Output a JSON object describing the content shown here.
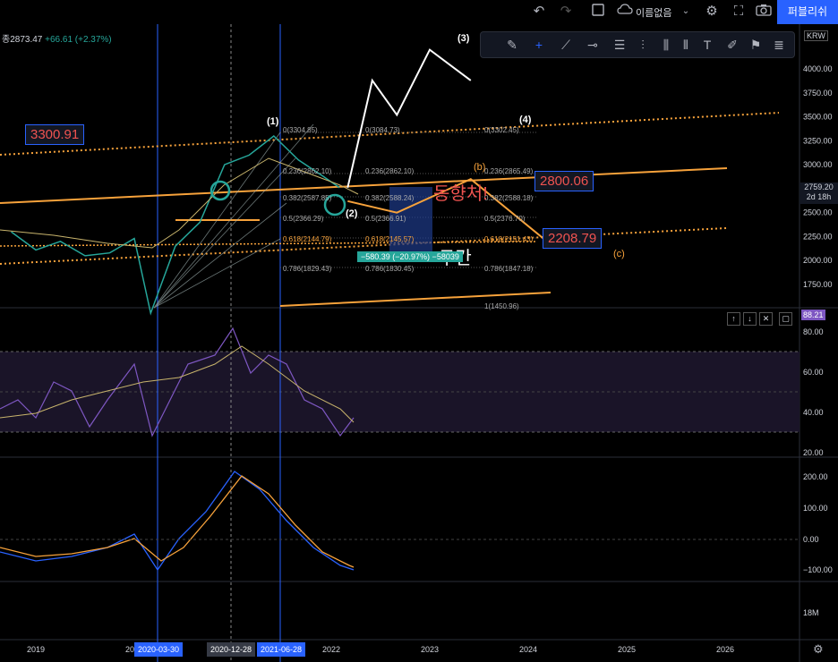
{
  "topbar": {
    "layout_name": "이름없음",
    "publish_label": "퍼블리쉬"
  },
  "symbol": {
    "info_prefix": "종",
    "price": "2873.47",
    "change": "+66.61 (+2.37%)"
  },
  "currency": "KRW",
  "annotations": {
    "top_left_price": "3300.91",
    "target_b": "2800.06",
    "target_c": "2208.79",
    "text_red": "동향처!",
    "text_white": "구간",
    "measure": "−580.39 (−20.97%) −58039"
  },
  "last_price": {
    "value": "2759.20",
    "timer": "2d 18h"
  },
  "waves": {
    "w1": "(1)",
    "w2": "(2)",
    "w3": "(3)",
    "w4": "(4)",
    "wb": "(b)",
    "wc": "(c)"
  },
  "fib": {
    "left": [
      "0(3304.85)",
      "0.236(2862.10)",
      "0.382(2587.85)",
      "0.5(2366.29)",
      "0.618(2144.79)",
      "0.786(1829.43)"
    ],
    "mid": [
      "0(3084.73)",
      "0.236(2862.10)",
      "0.382(2588.24)",
      "0.5(2366.91)",
      "0.618(2145.57)",
      "0.786(1830.45)"
    ],
    "right": [
      "0(3302.45)",
      "0.236(2865.49)",
      "0.382(2588.18)",
      "0.5(2376.70)",
      "0.618(2151.43)",
      "0.786(1847.18)",
      "1(1450.96)"
    ]
  },
  "rsi": {
    "value": "88.21",
    "ticks": [
      "80.00",
      "60.00",
      "40.00",
      "20.00"
    ]
  },
  "macd": {
    "ticks": [
      "200.00",
      "100.00",
      "0.00",
      "−100.00"
    ],
    "volume_tick": "18M"
  },
  "date_tags": [
    "2020-03-30",
    "2020-12-28",
    "2021-06-28"
  ],
  "chart_data": {
    "type": "line",
    "title": "",
    "price_axis": [
      "4000.00",
      "3750.00",
      "3500.00",
      "3250.00",
      "3000.00",
      "2750.00",
      "2500.00",
      "2250.00",
      "2000.00",
      "1750.00"
    ],
    "ylim": [
      1500,
      4250
    ],
    "time_axis": [
      "2019",
      "2020",
      "2021",
      "2022",
      "2023",
      "2024",
      "2025",
      "2026"
    ],
    "series": [
      {
        "x": [
          "2018-10",
          "2019-01",
          "2019-04",
          "2019-07",
          "2019-10",
          "2020-01",
          "2020-03",
          "2020-06",
          "2020-09",
          "2020-12",
          "2021-03",
          "2021-06",
          "2021-09",
          "2021-12",
          "2022-02"
        ],
        "values": [
          2300,
          2110,
          2200,
          2050,
          2080,
          2230,
          1450,
          2150,
          2400,
          3000,
          3100,
          3300,
          3050,
          2880,
          2760
        ]
      }
    ],
    "wave_projection": {
      "x": [
        "2022-03",
        "2022-06",
        "2022-09",
        "2023-01",
        "2023-06"
      ],
      "values": [
        2760,
        3880,
        3520,
        4200,
        3880
      ]
    },
    "abc_projection": {
      "x": [
        "2022-03",
        "2022-09",
        "2023-06",
        "2024-03"
      ],
      "values": [
        2620,
        2500,
        2850,
        2220
      ]
    }
  }
}
